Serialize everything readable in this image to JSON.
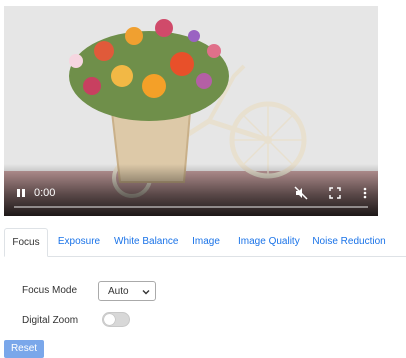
{
  "video": {
    "time": "0:00",
    "progress_fraction": 0.0,
    "icons": {
      "play": "pause-icon",
      "mute": "volume-muted-icon",
      "fullscreen": "fullscreen-icon",
      "menu": "more-vertical-icon"
    }
  },
  "tabs": [
    {
      "label": "Focus",
      "active": true
    },
    {
      "label": "Exposure",
      "active": false
    },
    {
      "label": "White Balance",
      "active": false
    },
    {
      "label": "Image",
      "active": false
    },
    {
      "label": "Image Quality",
      "active": false
    },
    {
      "label": "Noise Reduction",
      "active": false
    }
  ],
  "focus": {
    "mode_label": "Focus Mode",
    "mode_value": "Auto",
    "zoom_label": "Digital Zoom",
    "zoom_enabled": false
  },
  "reset_label": "Reset",
  "colors": {
    "accent": "#1a73e8",
    "reset": "#7aa7ea"
  }
}
